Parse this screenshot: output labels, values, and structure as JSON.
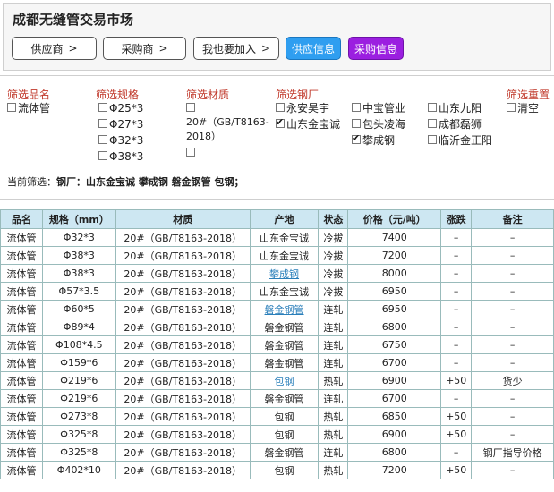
{
  "header": {
    "title": "成都无缝管交易市场",
    "buttons": [
      {
        "label": "供应商",
        "arrow": ">"
      },
      {
        "label": "采购商",
        "arrow": ">"
      },
      {
        "label": "我也要加入",
        "arrow": ">"
      },
      {
        "label": "供应信息"
      },
      {
        "label": "采购信息"
      }
    ]
  },
  "filters": {
    "product_title": "筛选品名",
    "product_items": [
      "流体管"
    ],
    "spec_title": "筛选规格",
    "spec_items": [
      "Φ25*3",
      "Φ27*3",
      "Φ32*3",
      "Φ38*3"
    ],
    "material_title": "筛选材质",
    "material_items": [
      "20#（GB/T8163-2018）"
    ],
    "mill_title": "筛选钢厂",
    "mill_col1": [
      "永安昊宇",
      "山东金宝诚"
    ],
    "mill_col2": [
      "中宝管业",
      "包头凌海",
      "攀成钢"
    ],
    "mill_col3": [
      "山东九阳",
      "成都磊狮",
      "临沂金正阳"
    ],
    "reset_title": "筛选重置",
    "clear_label": "清空",
    "current_label": "当前筛选：",
    "current_value": "钢厂：山东金宝诚 攀成钢 磐金钢管 包钢；"
  },
  "table": {
    "headers": [
      "品名",
      "规格（mm）",
      "材质",
      "产地",
      "状态",
      "价格（元/吨）",
      "涨跌",
      "备注"
    ],
    "rows": [
      [
        "流体管",
        "Φ32*3",
        "20#（GB/T8163-2018）",
        "山东金宝诚",
        "冷拔",
        "7400",
        "–",
        "–"
      ],
      [
        "流体管",
        "Φ38*3",
        "20#（GB/T8163-2018）",
        "山东金宝诚",
        "冷拔",
        "7200",
        "–",
        "–"
      ],
      [
        "流体管",
        "Φ38*3",
        "20#（GB/T8163-2018）",
        "攀成钢",
        "冷拔",
        "8000",
        "–",
        "–"
      ],
      [
        "流体管",
        "Φ57*3.5",
        "20#（GB/T8163-2018）",
        "山东金宝诚",
        "冷拔",
        "6950",
        "–",
        "–"
      ],
      [
        "流体管",
        "Φ60*5",
        "20#（GB/T8163-2018）",
        "磐金钢管",
        "连轧",
        "6950",
        "–",
        "–"
      ],
      [
        "流体管",
        "Φ89*4",
        "20#（GB/T8163-2018）",
        "磐金钢管",
        "连轧",
        "6800",
        "–",
        "–"
      ],
      [
        "流体管",
        "Φ108*4.5",
        "20#（GB/T8163-2018）",
        "磐金钢管",
        "连轧",
        "6750",
        "–",
        "–"
      ],
      [
        "流体管",
        "Φ159*6",
        "20#（GB/T8163-2018）",
        "磐金钢管",
        "连轧",
        "6700",
        "–",
        "–"
      ],
      [
        "流体管",
        "Φ219*6",
        "20#（GB/T8163-2018）",
        "包钢",
        "热轧",
        "6900",
        "+50",
        "货少"
      ],
      [
        "流体管",
        "Φ219*6",
        "20#（GB/T8163-2018）",
        "磐金钢管",
        "连轧",
        "6700",
        "–",
        "–"
      ],
      [
        "流体管",
        "Φ273*8",
        "20#（GB/T8163-2018）",
        "包钢",
        "热轧",
        "6850",
        "+50",
        "–"
      ],
      [
        "流体管",
        "Φ325*8",
        "20#（GB/T8163-2018）",
        "包钢",
        "热轧",
        "6900",
        "+50",
        "–"
      ],
      [
        "流体管",
        "Φ325*8",
        "20#（GB/T8163-2018）",
        "磐金钢管",
        "连轧",
        "6800",
        "–",
        "钢厂指导价格"
      ],
      [
        "流体管",
        "Φ402*10",
        "20#（GB/T8163-2018）",
        "包钢",
        "热轧",
        "7200",
        "+50",
        "–"
      ]
    ]
  },
  "colors": {
    "blue_button": "#2f9ef0",
    "purple_button": "#9b1fe0",
    "filter_heading": "#c0392b",
    "table_header": "#cde7f2",
    "link": "#2a7fba"
  }
}
